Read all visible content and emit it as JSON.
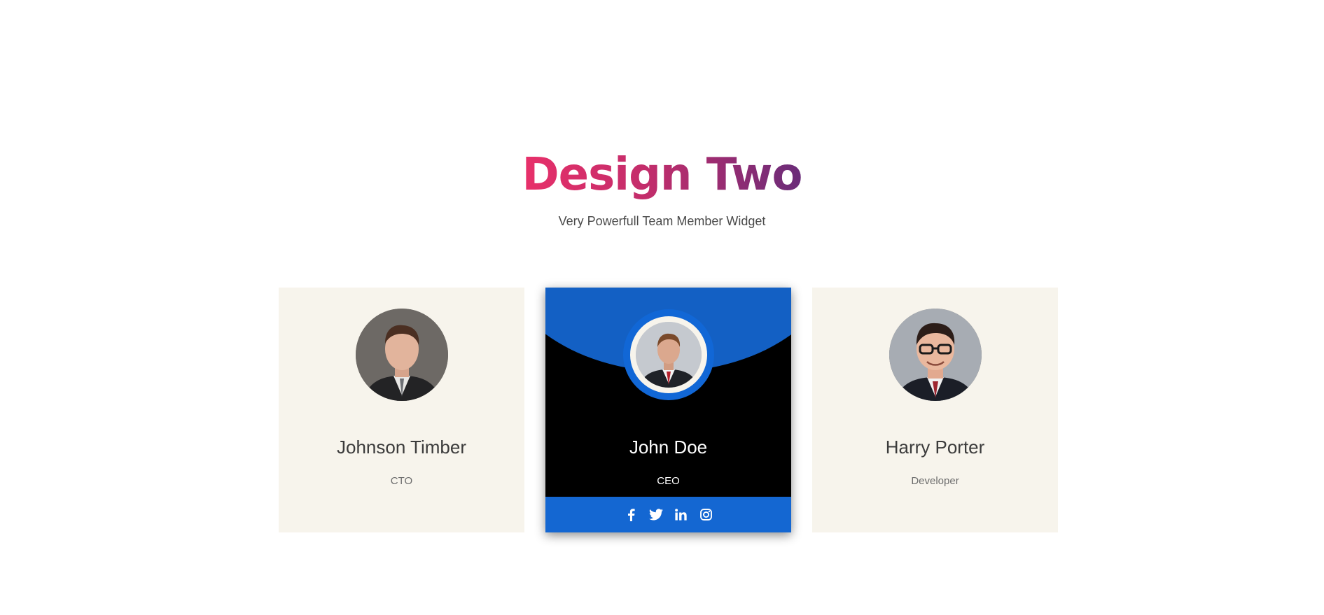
{
  "header": {
    "title": "Design Two",
    "subtitle": "Very Powerfull Team Member Widget"
  },
  "colors": {
    "title_gradient": [
      "#e8306a",
      "#6a2c79"
    ],
    "card_bg": "#f7f4ec",
    "featured_bg": "#000000",
    "featured_accent": "#1467d2"
  },
  "members": [
    {
      "name": "Johnson Timber",
      "role": "CTO"
    },
    {
      "name": "John Doe",
      "role": "CEO"
    },
    {
      "name": "Harry Porter",
      "role": "Developer"
    }
  ],
  "social_icons": [
    "facebook-icon",
    "twitter-icon",
    "linkedin-icon",
    "instagram-icon"
  ]
}
